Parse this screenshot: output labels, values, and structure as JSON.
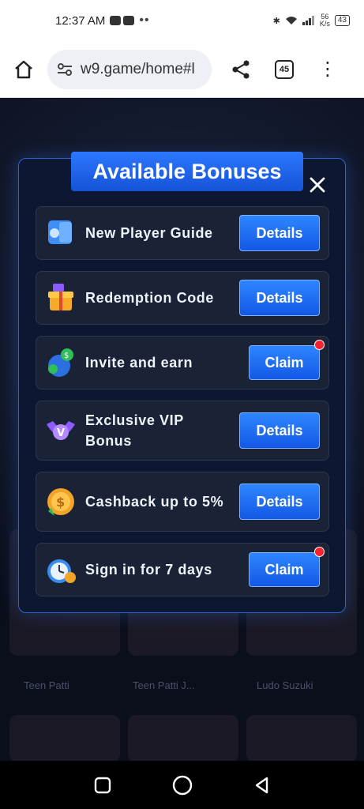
{
  "status": {
    "time": "12:37 AM",
    "net_speed_top": "56",
    "net_speed_unit": "K/s",
    "battery": "43"
  },
  "browser": {
    "url": "w9.game/home#l",
    "tab_count": "45"
  },
  "background_labels": [
    "Teen Patti",
    "Teen Patti J...",
    "Ludo Suzuki"
  ],
  "modal": {
    "title": "Available Bonuses",
    "rows": [
      {
        "label": "New Player Guide",
        "button": "Details",
        "icon": "guide-book-icon",
        "notify": false
      },
      {
        "label": "Redemption Code",
        "button": "Details",
        "icon": "gift-box-icon",
        "notify": false
      },
      {
        "label": "Invite and earn",
        "button": "Claim",
        "icon": "money-bag-icon",
        "notify": true
      },
      {
        "label": "Exclusive VIP Bonus",
        "button": "Details",
        "icon": "vip-badge-icon",
        "notify": false
      },
      {
        "label": "Cashback up to 5%",
        "button": "Details",
        "icon": "cashback-coin-icon",
        "notify": false
      },
      {
        "label": "Sign in for 7 days",
        "button": "Claim",
        "icon": "alarm-clock-icon",
        "notify": true
      }
    ]
  },
  "colors": {
    "accent": "#1f6bff",
    "notify": "#ff1f2d",
    "modal_bg": "#0e1731"
  }
}
